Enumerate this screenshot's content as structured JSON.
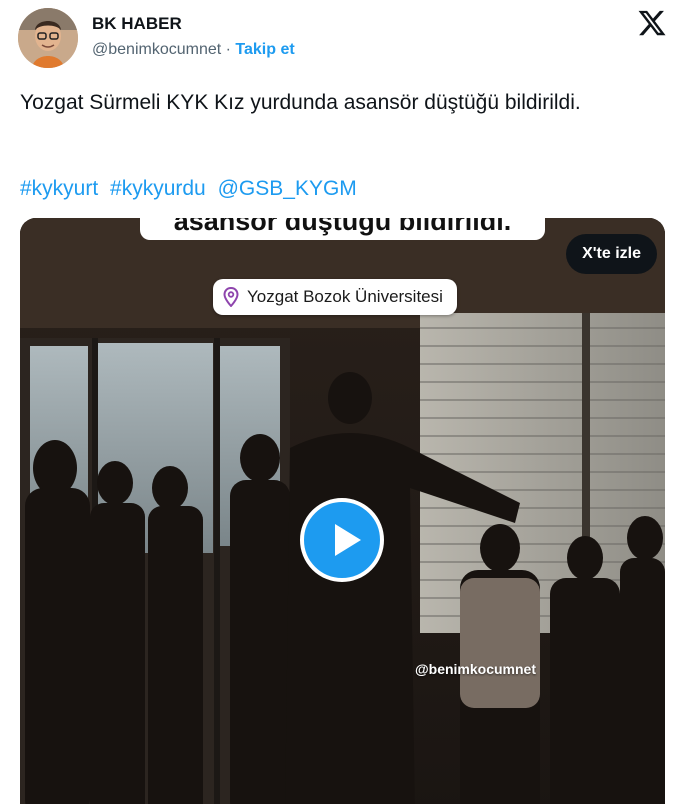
{
  "author": {
    "display_name": "BK HABER",
    "handle": "@benimkocumnet",
    "separator": "·",
    "follow_label": "Takip et"
  },
  "tweet": {
    "text": "Yozgat Sürmeli KYK Kız yurdunda asansör düştüğü bildirildi.",
    "hashtags": [
      "#kykyurt",
      "#kykyurdu",
      "@GSB_KYGM"
    ]
  },
  "media": {
    "caption_overlay": "asansör düştüğü bildirildi.",
    "location_tag": "Yozgat Bozok Üniversitesi",
    "watch_button": "X'te izle",
    "watermark": "@benimkocumnet"
  },
  "icons": {
    "platform_logo": "x-logo-icon",
    "play": "play-icon",
    "location": "map-pin-icon"
  },
  "colors": {
    "accent": "#1d9bf0",
    "text": "#0f1419",
    "secondary_text": "#536471"
  }
}
